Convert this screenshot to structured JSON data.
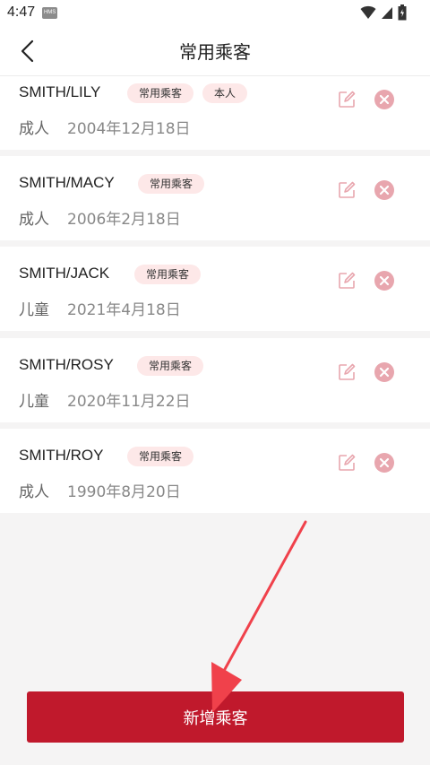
{
  "status": {
    "time": "4:47",
    "badge": "HMS"
  },
  "header": {
    "title": "常用乘客"
  },
  "passengers": [
    {
      "name": "SMITH/LILY",
      "tags": [
        "常用乘客",
        "本人"
      ],
      "type": "成人",
      "birthdate": "2004年12月18日"
    },
    {
      "name": "SMITH/MACY",
      "tags": [
        "常用乘客"
      ],
      "type": "成人",
      "birthdate": "2006年2月18日"
    },
    {
      "name": "SMITH/JACK",
      "tags": [
        "常用乘客"
      ],
      "type": "儿童",
      "birthdate": "2021年4月18日"
    },
    {
      "name": "SMITH/ROSY",
      "tags": [
        "常用乘客"
      ],
      "type": "儿童",
      "birthdate": "2020年11月22日"
    },
    {
      "name": "SMITH/ROY",
      "tags": [
        "常用乘客"
      ],
      "type": "成人",
      "birthdate": "1990年8月20日"
    }
  ],
  "footer": {
    "add_label": "新增乘客"
  },
  "colors": {
    "accent": "#c0192c",
    "tag_bg": "#fde8e8",
    "icon_pink": "#e8a6ae"
  }
}
